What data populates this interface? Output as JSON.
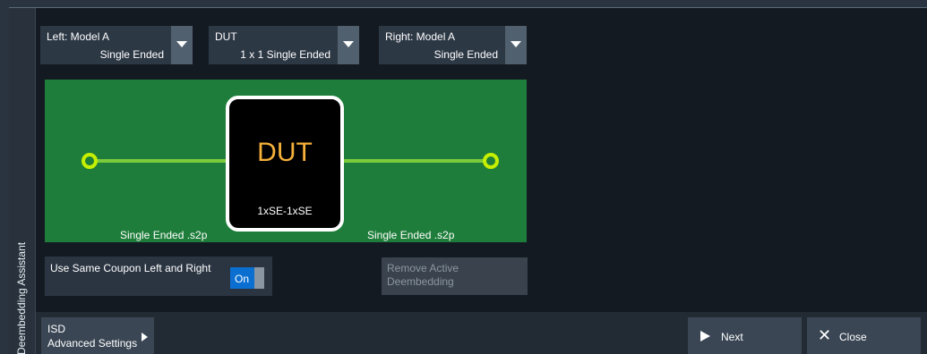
{
  "sidebar": {
    "title": "Deembedding Assistant"
  },
  "dropdowns": {
    "left": {
      "label": "Left: Model A",
      "value": "Single Ended"
    },
    "dut": {
      "label": "DUT",
      "value": "1 x 1 Single Ended"
    },
    "right": {
      "label": "Right: Model A",
      "value": "Single Ended"
    }
  },
  "diagram": {
    "dut_title": "DUT",
    "dut_config": "1xSE-1xSE",
    "left_file": "Single Ended .s2p",
    "right_file": "Single Ended .s2p",
    "colors": {
      "background": "#1e7d3a",
      "wire": "#7ccb3c",
      "port": "#c5ef00",
      "dut_text": "#f5b13a"
    }
  },
  "coupon": {
    "label": "Use Same Coupon Left and Right",
    "toggle_state": "On"
  },
  "remove_button": {
    "line1": "Remove Active",
    "line2": "Deembedding"
  },
  "footer": {
    "isd_line1": "ISD",
    "isd_line2": "Advanced Settings",
    "next_label": "Next",
    "close_label": "Close",
    "close_glyph": "✕"
  }
}
